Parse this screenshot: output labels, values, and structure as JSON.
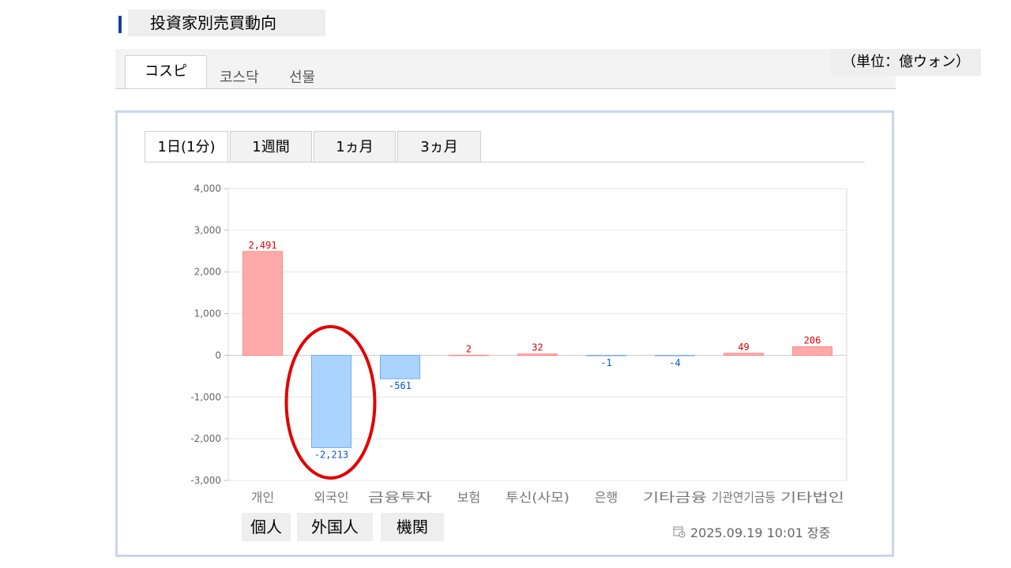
{
  "page": {
    "title": "投資家別売買動向",
    "unit": "（単位：億ウォン）"
  },
  "market_tabs": [
    {
      "label": "コスピ",
      "active": true
    },
    {
      "label": "코스닥",
      "active": false
    },
    {
      "label": "선물",
      "active": false
    }
  ],
  "period_tabs": [
    {
      "label": "1日(1分)",
      "active": true
    },
    {
      "label": "1週間",
      "active": false
    },
    {
      "label": "1ヵ月",
      "active": false
    },
    {
      "label": "3ヵ月",
      "active": false
    }
  ],
  "investor_labels": [
    "個人",
    "外国人",
    "機関"
  ],
  "timestamp": "2025.09.19 10:01 장중",
  "colors": {
    "positive_fill": "#ffaaaa",
    "positive_stroke": "#ff8888",
    "negative_fill": "#aad4ff",
    "negative_stroke": "#77aaee",
    "positive_text": "#e60000",
    "negative_text": "#0055cc",
    "highlight_circle": "#e00000",
    "title_accent": "#1f3e9a"
  },
  "chart_data": {
    "type": "bar",
    "categories": [
      "개인",
      "외국인",
      "금융투자",
      "보험",
      "투신(사모)",
      "은행",
      "기타금융",
      "기관연기금등",
      "기타법인"
    ],
    "values": [
      2491,
      -2213,
      -561,
      2,
      32,
      -1,
      -4,
      49,
      206
    ],
    "value_labels": [
      "2,491",
      "-2,213",
      "-561",
      "2",
      "32",
      "-1",
      "-4",
      "49",
      "206"
    ],
    "yticks": [
      "4,000",
      "3,000",
      "2,000",
      "1,000",
      "0",
      "-1,000",
      "-2,000",
      "-3,000"
    ],
    "ytick_values": [
      4000,
      3000,
      2000,
      1000,
      0,
      -1000,
      -2000,
      -3000
    ],
    "ylim": [
      -3000,
      4000
    ],
    "grid": true,
    "highlighted_category": "외국인"
  }
}
